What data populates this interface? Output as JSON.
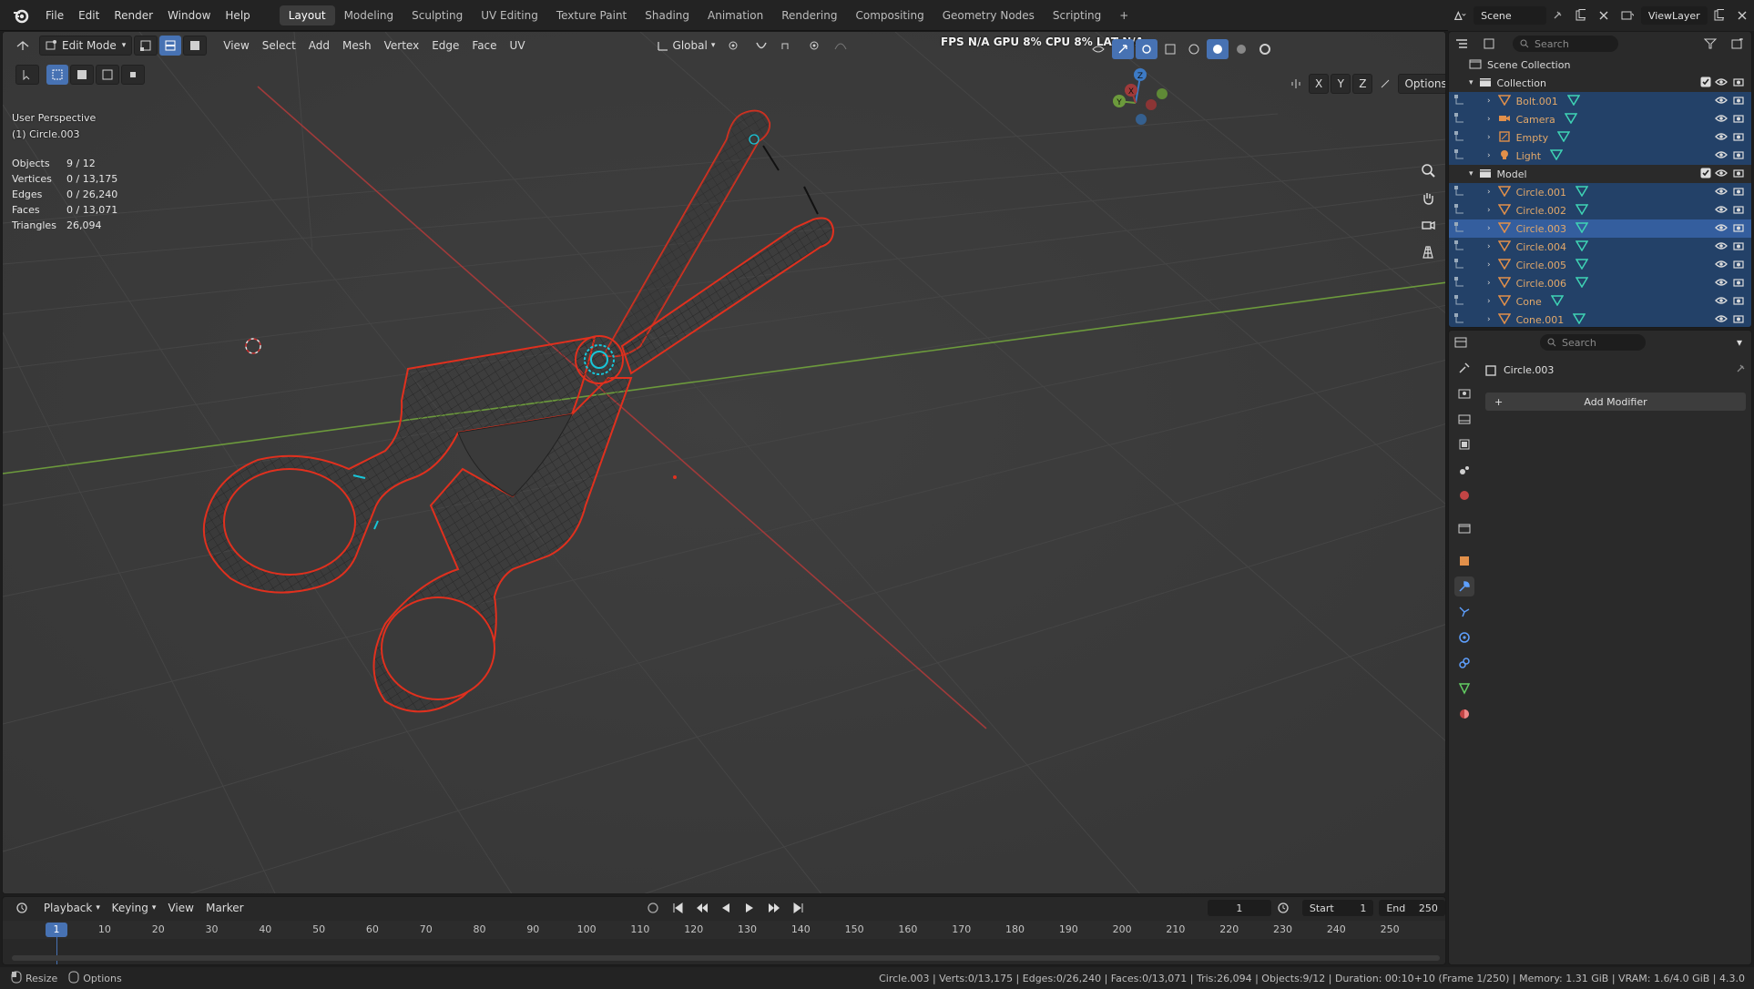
{
  "menubar": {
    "items": [
      "File",
      "Edit",
      "Render",
      "Window",
      "Help"
    ],
    "workspaces": [
      "Layout",
      "Modeling",
      "Sculpting",
      "UV Editing",
      "Texture Paint",
      "Shading",
      "Animation",
      "Rendering",
      "Compositing",
      "Geometry Nodes",
      "Scripting"
    ],
    "active_workspace": "Layout",
    "add_tab": "+",
    "scene_label": "Scene",
    "viewlayer_label": "ViewLayer"
  },
  "viewport": {
    "mode": "Edit Mode",
    "menus": [
      "View",
      "Select",
      "Add",
      "Mesh",
      "Vertex",
      "Edge",
      "Face",
      "UV"
    ],
    "orientation": "Global",
    "options_label": "Options",
    "axis_x": "X",
    "axis_y": "Y",
    "axis_z": "Z",
    "perf_overlay": "FPS  N/A  GPU  8%  CPU  8%  LAT  N/A",
    "view_name": "User Perspective",
    "object_name": "(1) Circle.003",
    "stats": [
      {
        "label": "Objects",
        "value": "9 / 12"
      },
      {
        "label": "Vertices",
        "value": "0 / 13,175"
      },
      {
        "label": "Edges",
        "value": "0 / 26,240"
      },
      {
        "label": "Faces",
        "value": "0 / 13,071"
      },
      {
        "label": "Triangles",
        "value": "26,094"
      }
    ],
    "gizmo": {
      "x": "X",
      "y": "Y",
      "z": "Z"
    }
  },
  "timeline": {
    "menus": [
      "Playback",
      "Keying",
      "View",
      "Marker"
    ],
    "current_frame": "1",
    "start_label": "Start",
    "start": "1",
    "end_label": "End",
    "end": "250",
    "ticks": [
      "1",
      "10",
      "20",
      "30",
      "40",
      "50",
      "60",
      "70",
      "80",
      "90",
      "100",
      "110",
      "120",
      "130",
      "140",
      "150",
      "160",
      "170",
      "180",
      "190",
      "200",
      "210",
      "220",
      "230",
      "240",
      "250"
    ]
  },
  "statusbar": {
    "left_1": "Resize",
    "left_2": "Options",
    "right": "Circle.003 | Verts:0/13,175 | Edges:0/26,240 | Faces:0/13,071 | Tris:26,094 | Objects:9/12 | Duration: 00:10+10 (Frame 1/250) | Memory: 1.31 GiB | VRAM: 1.6/4.0 GiB | 4.3.0"
  },
  "outliner": {
    "search_placeholder": "Search",
    "scene_collection": "Scene Collection",
    "collections": [
      {
        "name": "Collection",
        "items": [
          "Bolt.001",
          "Camera",
          "Empty",
          "Light"
        ]
      },
      {
        "name": "Model",
        "items": [
          "Circle.001",
          "Circle.002",
          "Circle.003",
          "Circle.004",
          "Circle.005",
          "Circle.006",
          "Cone",
          "Cone.001"
        ]
      }
    ],
    "active_item": "Circle.003"
  },
  "properties": {
    "search_placeholder": "Search",
    "object_name": "Circle.003",
    "add_modifier": "Add Modifier",
    "add_icon": "+"
  },
  "colors": {
    "accent": "#4772b3",
    "selected_outline": "#e0301e",
    "edit_vertex": "#18c6d9",
    "x_axis": "#a03a3a",
    "y_axis": "#6c9a3c"
  }
}
